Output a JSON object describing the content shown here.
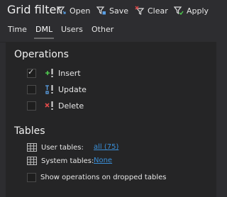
{
  "toolbar": {
    "title": "Grid filter",
    "open_label": "Open",
    "save_label": "Save",
    "clear_label": "Clear",
    "apply_label": "Apply"
  },
  "tabs": [
    {
      "label": "Time",
      "active": false
    },
    {
      "label": "DML",
      "active": true
    },
    {
      "label": "Users",
      "active": false
    },
    {
      "label": "Other",
      "active": false
    }
  ],
  "operations": {
    "title": "Operations",
    "items": [
      {
        "label": "Insert",
        "checked": true,
        "icon": "insert-icon"
      },
      {
        "label": "Update",
        "checked": false,
        "icon": "update-icon"
      },
      {
        "label": "Delete",
        "checked": false,
        "icon": "delete-icon"
      }
    ]
  },
  "tables": {
    "title": "Tables",
    "user_tables_label": "User tables:",
    "user_tables_value": "all (75)",
    "system_tables_label": "System tables:",
    "system_tables_value": "None",
    "dropped_label": "Show operations on dropped tables",
    "dropped_checked": false
  },
  "colors": {
    "background": "#2d2d30",
    "panel": "#252526",
    "link": "#3a8fd8",
    "insert_plus": "#4ec94e",
    "delete_x": "#e04a4a"
  }
}
